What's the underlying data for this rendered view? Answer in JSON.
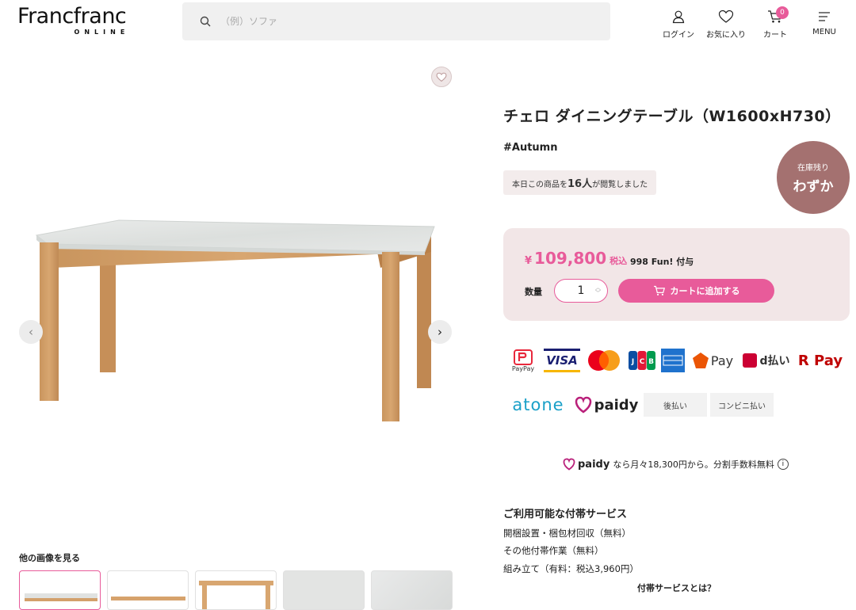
{
  "header": {
    "logo_main": "Francfranc",
    "logo_sub": "ONLINE",
    "search_placeholder": "（例）ソファ",
    "nav": {
      "login": "ログイン",
      "favorites": "お気に入り",
      "cart": "カート",
      "cart_count": "0",
      "menu": "MENU"
    }
  },
  "gallery": {
    "other_images_label": "他の画像を見る"
  },
  "product": {
    "title": "チェロ ダイニングテーブル（W1600xH730）",
    "tag": "#Autumn",
    "viewed_prefix": "本日この商品を",
    "viewed_count": "16人",
    "viewed_suffix": "が閲覧しました",
    "stock_line1": "在庫残り",
    "stock_line2": "わずか",
    "price_symbol": "¥",
    "price": "109,800",
    "tax_label": "税込",
    "points": "998 Fun! 付与",
    "qty_label": "数量",
    "qty_value": "1",
    "add_to_cart": "カートに追加する"
  },
  "payments": {
    "paypay": "PayPay",
    "visa": "VISA",
    "au_pay": "Pay",
    "d_pay": "d払い",
    "r_pay": "R Pay",
    "atone": "atone",
    "paidy": "paidy",
    "deferred": "後払い",
    "convenience": "コンビニ払い"
  },
  "paidy_info": {
    "brand": "paidy",
    "text": "なら月々18,300円から。分割手数料無料"
  },
  "services": {
    "title": "ご利用可能な付帯サービス",
    "items": [
      "開梱設置・梱包材回収（無料）",
      "その他付帯作業（無料）",
      "組み立て（有料：税込3,960円）"
    ],
    "link": "付帯サービスとは？"
  },
  "colors": {
    "accent_pink": "#e85b9a",
    "stock_badge": "#a47170",
    "price_bg": "#f2e6e7"
  }
}
